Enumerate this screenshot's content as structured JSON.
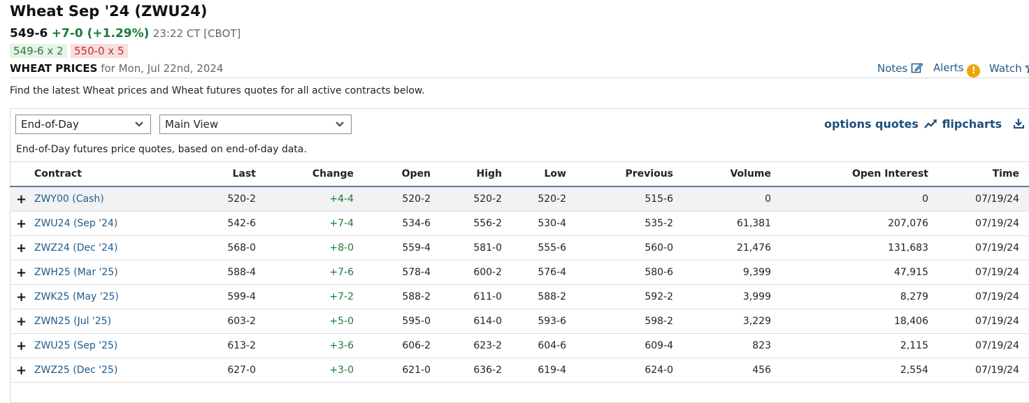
{
  "header": {
    "title": "Wheat Sep '24 (ZWU24)",
    "last": "549-6",
    "change": "+7-0 (+1.29%)",
    "time": "23:22 CT [CBOT]",
    "bid": "549-6 x 2",
    "ask": "550-0 x 5",
    "prices_label": "WHEAT PRICES",
    "prices_date": "for Mon, Jul 22nd, 2024"
  },
  "links": {
    "notes": "Notes",
    "alerts": "Alerts",
    "watch": "Watch"
  },
  "description": "Find the latest Wheat prices and Wheat futures quotes for all active contracts below.",
  "controls": {
    "period": "End-of-Day",
    "view": "Main View",
    "options_quotes": "options quotes",
    "flipcharts": "flipcharts",
    "note": "End-of-Day futures price quotes, based on end-of-day data."
  },
  "table": {
    "columns": [
      "Contract",
      "Last",
      "Change",
      "Open",
      "High",
      "Low",
      "Previous",
      "Volume",
      "Open Interest",
      "Time"
    ],
    "rows": [
      {
        "contract": "ZWY00 (Cash)",
        "last": "520-2",
        "change": "+4-4",
        "open": "520-2",
        "high": "520-2",
        "low": "520-2",
        "previous": "515-6",
        "volume": "0",
        "oi": "0",
        "time": "07/19/24"
      },
      {
        "contract": "ZWU24 (Sep '24)",
        "last": "542-6",
        "change": "+7-4",
        "open": "534-6",
        "high": "556-2",
        "low": "530-4",
        "previous": "535-2",
        "volume": "61,381",
        "oi": "207,076",
        "time": "07/19/24"
      },
      {
        "contract": "ZWZ24 (Dec '24)",
        "last": "568-0",
        "change": "+8-0",
        "open": "559-4",
        "high": "581-0",
        "low": "555-6",
        "previous": "560-0",
        "volume": "21,476",
        "oi": "131,683",
        "time": "07/19/24"
      },
      {
        "contract": "ZWH25 (Mar '25)",
        "last": "588-4",
        "change": "+7-6",
        "open": "578-4",
        "high": "600-2",
        "low": "576-4",
        "previous": "580-6",
        "volume": "9,399",
        "oi": "47,915",
        "time": "07/19/24"
      },
      {
        "contract": "ZWK25 (May '25)",
        "last": "599-4",
        "change": "+7-2",
        "open": "588-2",
        "high": "611-0",
        "low": "588-2",
        "previous": "592-2",
        "volume": "3,999",
        "oi": "8,279",
        "time": "07/19/24"
      },
      {
        "contract": "ZWN25 (Jul '25)",
        "last": "603-2",
        "change": "+5-0",
        "open": "595-0",
        "high": "614-0",
        "low": "593-6",
        "previous": "598-2",
        "volume": "3,229",
        "oi": "18,406",
        "time": "07/19/24"
      },
      {
        "contract": "ZWU25 (Sep '25)",
        "last": "613-2",
        "change": "+3-6",
        "open": "606-2",
        "high": "623-2",
        "low": "604-6",
        "previous": "609-4",
        "volume": "823",
        "oi": "2,115",
        "time": "07/19/24"
      },
      {
        "contract": "ZWZ25 (Dec '25)",
        "last": "627-0",
        "change": "+3-0",
        "open": "621-0",
        "high": "636-2",
        "low": "619-4",
        "previous": "624-0",
        "volume": "456",
        "oi": "2,554",
        "time": "07/19/24"
      }
    ]
  }
}
